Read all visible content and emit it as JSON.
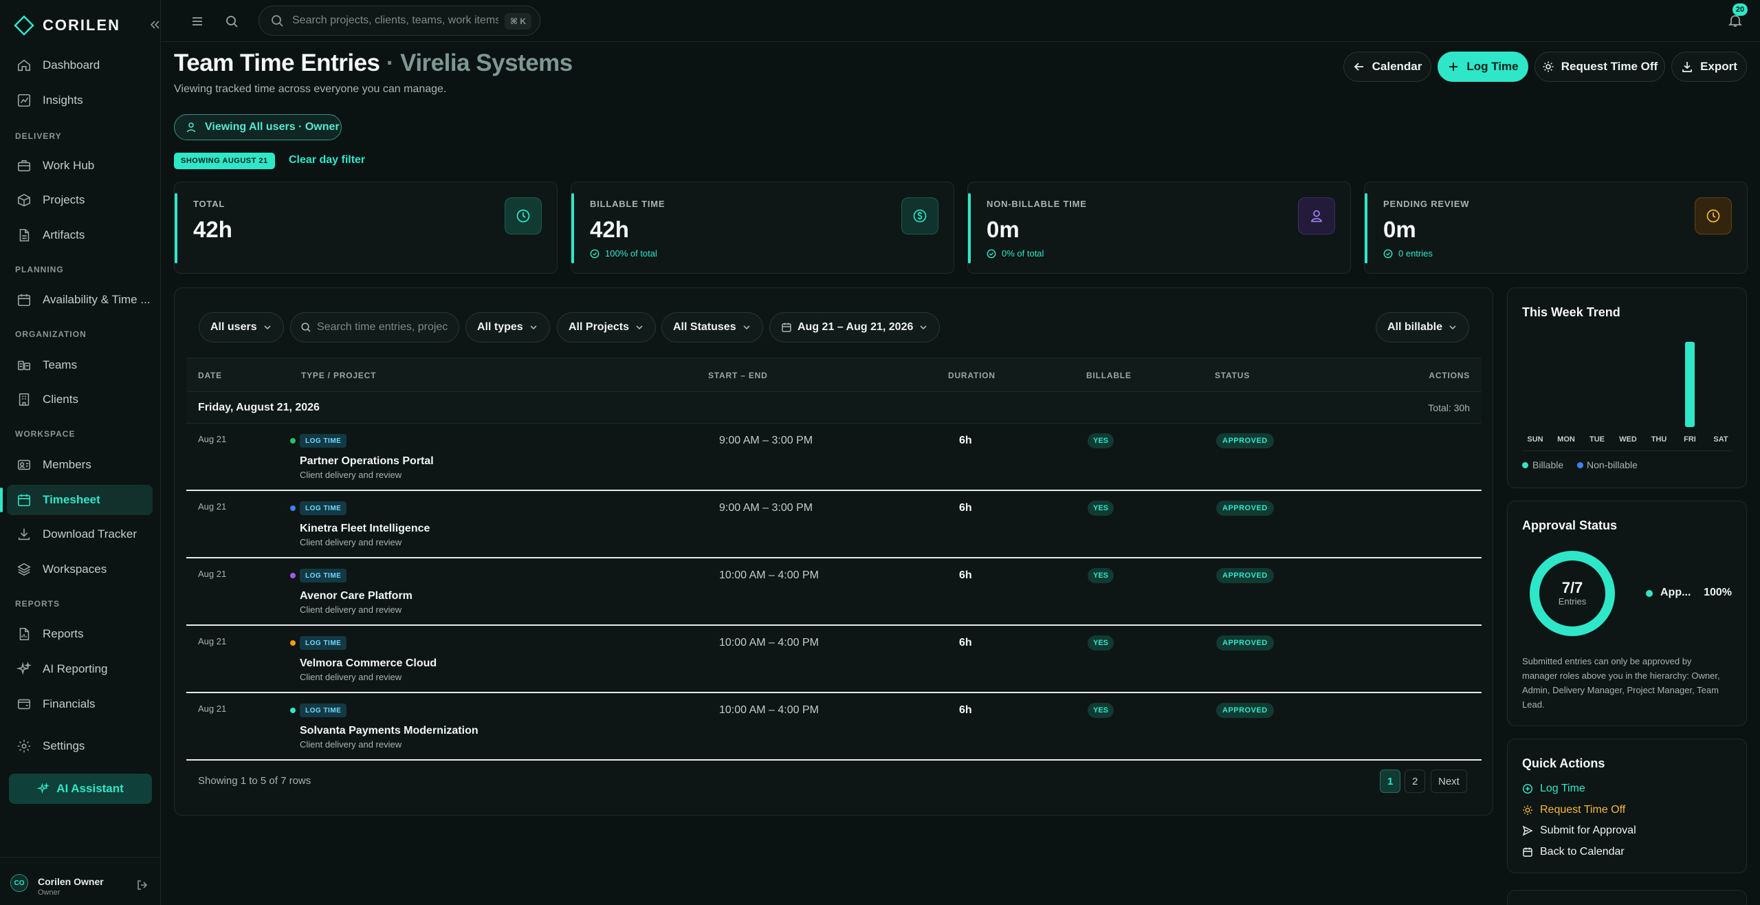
{
  "brand": {
    "name": "CORILEN"
  },
  "sidebar": {
    "items": [
      {
        "label": "Dashboard",
        "icon": "home-icon"
      },
      {
        "label": "Insights",
        "icon": "chart-icon"
      },
      {
        "label": "Work Hub",
        "icon": "briefcase-icon"
      },
      {
        "label": "Projects",
        "icon": "box-icon"
      },
      {
        "label": "Artifacts",
        "icon": "file-icon"
      },
      {
        "label": "Availability & Time ...",
        "icon": "calendar-icon"
      },
      {
        "label": "Teams",
        "icon": "teams-icon"
      },
      {
        "label": "Clients",
        "icon": "building-icon"
      },
      {
        "label": "Members",
        "icon": "id-card-icon"
      },
      {
        "label": "Timesheet",
        "icon": "calendar-icon"
      },
      {
        "label": "Download Tracker",
        "icon": "download-icon"
      },
      {
        "label": "Workspaces",
        "icon": "layers-icon"
      },
      {
        "label": "Reports",
        "icon": "report-icon"
      },
      {
        "label": "AI Reporting",
        "icon": "sparkle-icon"
      },
      {
        "label": "Financials",
        "icon": "wallet-icon"
      },
      {
        "label": "Settings",
        "icon": "gear-icon"
      }
    ],
    "sections": [
      "DELIVERY",
      "PLANNING",
      "ORGANIZATION",
      "WORKSPACE",
      "REPORTS"
    ],
    "ai_button": "AI Assistant",
    "user": {
      "initials": "CO",
      "name": "Corilen Owner",
      "role": "Owner"
    }
  },
  "topbar": {
    "search_placeholder": "Search projects, clients, teams, work items",
    "shortcut": "⌘ K",
    "notifications": "20"
  },
  "header": {
    "title": "Team Time Entries",
    "separator": "·",
    "org": "Virelia Systems",
    "subtitle": "Viewing tracked time across everyone you can manage.",
    "buttons": {
      "calendar": "Calendar",
      "log_time": "Log Time",
      "request_time_off": "Request Time Off",
      "export": "Export"
    },
    "viewing": "Viewing All users · Owner",
    "day_tag": "SHOWING AUGUST 21",
    "clear_filter": "Clear day filter"
  },
  "stats": [
    {
      "label": "TOTAL",
      "value": "42h",
      "sub": ""
    },
    {
      "label": "BILLABLE TIME",
      "value": "42h",
      "sub": "100% of total"
    },
    {
      "label": "NON-BILLABLE TIME",
      "value": "0m",
      "sub": "0% of total"
    },
    {
      "label": "PENDING REVIEW",
      "value": "0m",
      "sub": "0 entries"
    }
  ],
  "filters": {
    "users": "All users",
    "search_placeholder": "Search time entries, projects",
    "types": "All types",
    "projects": "All Projects",
    "statuses": "All Statuses",
    "date_range": "Aug 21 – Aug 21, 2026",
    "billable": "All billable"
  },
  "table": {
    "headers": {
      "date": "DATE",
      "type_project": "TYPE / PROJECT",
      "start_end": "START – END",
      "duration": "DURATION",
      "billable": "BILLABLE",
      "status": "STATUS",
      "actions": "ACTIONS"
    },
    "group": {
      "title": "Friday, August 21, 2026",
      "total": "Total: 30h"
    },
    "rows": [
      {
        "date": "Aug 21",
        "type": "LOG TIME",
        "project": "Partner Operations Portal",
        "desc": "Client delivery and review",
        "time": "9:00 AM – 3:00 PM",
        "duration": "6h",
        "billable": "YES",
        "status": "APPROVED",
        "dot": "#22c55e"
      },
      {
        "date": "Aug 21",
        "type": "LOG TIME",
        "project": "Kinetra Fleet Intelligence",
        "desc": "Client delivery and review",
        "time": "9:00 AM – 3:00 PM",
        "duration": "6h",
        "billable": "YES",
        "status": "APPROVED",
        "dot": "#3b82f6"
      },
      {
        "date": "Aug 21",
        "type": "LOG TIME",
        "project": "Avenor Care Platform",
        "desc": "Client delivery and review",
        "time": "10:00 AM – 4:00 PM",
        "duration": "6h",
        "billable": "YES",
        "status": "APPROVED",
        "dot": "#a855f7"
      },
      {
        "date": "Aug 21",
        "type": "LOG TIME",
        "project": "Velmora Commerce Cloud",
        "desc": "Client delivery and review",
        "time": "10:00 AM – 4:00 PM",
        "duration": "6h",
        "billable": "YES",
        "status": "APPROVED",
        "dot": "#f59e0b"
      },
      {
        "date": "Aug 21",
        "type": "LOG TIME",
        "project": "Solvanta Payments Modernization",
        "desc": "Client delivery and review",
        "time": "10:00 AM – 4:00 PM",
        "duration": "6h",
        "billable": "YES",
        "status": "APPROVED",
        "dot": "#2ee6c8"
      }
    ],
    "footer": "Showing 1 to 5 of 7 rows",
    "pages": [
      "1",
      "2"
    ],
    "next": "Next"
  },
  "trend": {
    "title": "This Week Trend",
    "days": [
      "SUN",
      "MON",
      "TUE",
      "WED",
      "THU",
      "FRI",
      "SAT"
    ],
    "billable_hours": [
      0,
      0,
      0,
      0,
      0,
      42,
      0
    ],
    "legend": [
      "Billable",
      "Non-billable"
    ]
  },
  "approval": {
    "title": "Approval Status",
    "count": "7/7",
    "count_label": "Entries",
    "legend_label": "App...",
    "legend_value": "100%",
    "approved_fraction": 1.0,
    "note": "Submitted entries can only be approved by manager roles above you in the hierarchy: Owner, Admin, Delivery Manager, Project Manager, Team Lead."
  },
  "quick_actions": {
    "title": "Quick Actions",
    "items": [
      {
        "label": "Log Time",
        "color": "#2ee6c8"
      },
      {
        "label": "Request Time Off",
        "color": "#f5b83d"
      },
      {
        "label": "Submit for Approval",
        "color": "#eef2f1"
      },
      {
        "label": "Back to Calendar",
        "color": "#eef2f1"
      }
    ]
  },
  "colors": {
    "accent": "#2ee6c8",
    "background": "#0b1312"
  }
}
